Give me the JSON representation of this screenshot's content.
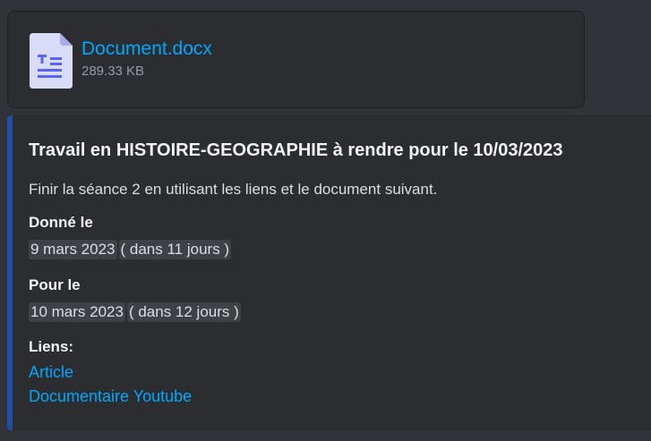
{
  "attachment": {
    "file_name": "Document.docx",
    "file_size": "289.33 KB",
    "icon": "document-file-icon"
  },
  "embed": {
    "accent_color": "#1e4fa3",
    "title": "Travail en HISTOIRE-GEOGRAPHIE à rendre pour le 10/03/2023",
    "description": "Finir la séance 2 en utilisant les liens et le document suivant.",
    "fields": [
      {
        "name": "Donné le",
        "date": "9 mars 2023",
        "relative": "( dans 11 jours )"
      },
      {
        "name": "Pour le",
        "date": "10 mars 2023",
        "relative": "( dans 12 jours )"
      }
    ],
    "links_label": "Liens:",
    "links": [
      "Article",
      "Documentaire Youtube"
    ]
  },
  "colors": {
    "background": "#313338",
    "card": "#2b2d31",
    "link": "#00a8fc",
    "timestamp_bg": "#3f4147"
  }
}
